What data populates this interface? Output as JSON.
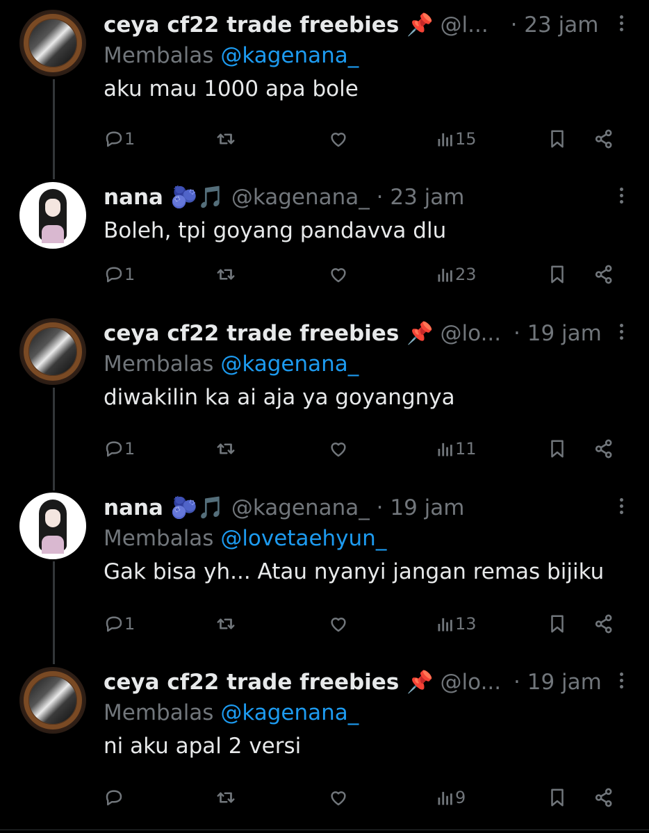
{
  "tweets": [
    {
      "author": "ceya cf22 trade freebies 📌",
      "handle": "@l...",
      "time": "23 jam",
      "reply_label": "Membalas",
      "reply_to": "@kagenana_",
      "text": "aku mau 1000 apa bole",
      "replies": "1",
      "views": "15",
      "avatar": "ceya"
    },
    {
      "author": "nana 🫐🎵",
      "handle": "@kagenana_",
      "time": "23 jam",
      "reply_label": "",
      "reply_to": "",
      "text": "Boleh, tpi goyang pandavva dlu",
      "replies": "1",
      "views": "23",
      "avatar": "nana"
    },
    {
      "author": "ceya cf22 trade freebies 📌",
      "handle": "@lo...",
      "time": "19 jam",
      "reply_label": "Membalas",
      "reply_to": "@kagenana_",
      "text": "diwakilin ka ai aja ya goyangnya",
      "replies": "1",
      "views": "11",
      "avatar": "ceya"
    },
    {
      "author": "nana 🫐🎵",
      "handle": "@kagenana_",
      "time": "19 jam",
      "reply_label": "Membalas",
      "reply_to": "@lovetaehyun_",
      "text": "Gak bisa yh... Atau nyanyi jangan remas bijiku",
      "replies": "1",
      "views": "13",
      "avatar": "nana"
    },
    {
      "author": "ceya cf22 trade freebies 📌",
      "handle": "@lo...",
      "time": "19 jam",
      "reply_label": "Membalas",
      "reply_to": "@kagenana_",
      "text": "ni aku apal 2 versi",
      "replies": "",
      "views": "9",
      "avatar": "ceya"
    }
  ],
  "separator": "·",
  "colors": {
    "background": "#000000",
    "text": "#e7e9ea",
    "muted": "#71767b",
    "link": "#1d9bf0",
    "thread_line": "#333639"
  }
}
